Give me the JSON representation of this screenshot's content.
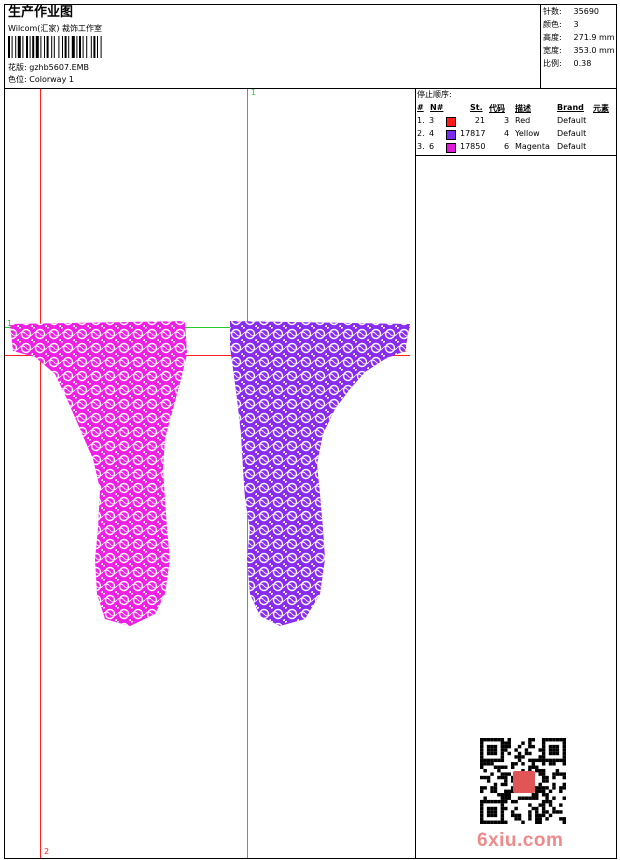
{
  "header": {
    "title": "生产作业图",
    "subtitle": "Wilcom(汇家) 裁饰工作室",
    "design_label": "花版:",
    "design_value": "gzhb5607.EMB",
    "colorway_label": "色位:",
    "colorway_value": "Colorway 1"
  },
  "stats": [
    {
      "label": "针数:",
      "value": "35690"
    },
    {
      "label": "颜色:",
      "value": "3"
    },
    {
      "label": "高度:",
      "value": "271.9 mm"
    },
    {
      "label": "宽度:",
      "value": "353.0 mm"
    },
    {
      "label": "比例:",
      "value": "0.38"
    }
  ],
  "stop_sequence": {
    "title": "停止顺序:",
    "headers": {
      "num": "#",
      "n": "N#",
      "st": "St.",
      "code": "代码",
      "desc": "描述",
      "brand": "Brand",
      "element": "元素"
    },
    "rows": [
      {
        "num": "1.",
        "n": "3",
        "color": "#ff1a1a",
        "st": "21",
        "code": "3",
        "desc": "Red",
        "brand": "Default"
      },
      {
        "num": "2.",
        "n": "4",
        "color": "#7a2cf0",
        "st": "17817",
        "code": "4",
        "desc": "Yellow",
        "brand": "Default"
      },
      {
        "num": "3.",
        "n": "6",
        "color": "#e21bd8",
        "st": "17850",
        "code": "6",
        "desc": "Magenta",
        "brand": "Default"
      }
    ]
  },
  "guides": {
    "label_top": "1",
    "label_left": "1",
    "label_right": "2",
    "label_bottom": "2",
    "green": "#22cc22",
    "red": "#ff2020"
  },
  "design_colors": {
    "left_panel": "#ef1fe6",
    "right_panel": "#8a2cf0"
  },
  "watermark": "6xiu.com"
}
